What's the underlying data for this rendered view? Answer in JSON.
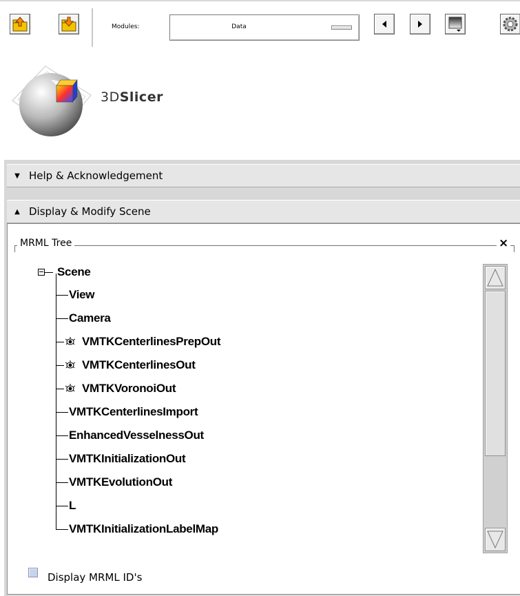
{
  "toolbar": {
    "modules_label": "Modules:",
    "module_selected": "Data",
    "buttons": [
      "load-scene-icon",
      "import-scene-icon",
      "prev-module-icon",
      "next-module-icon",
      "module-menu-icon",
      "settings-icon"
    ]
  },
  "logo": {
    "text_prefix": "3D",
    "text_bold": "Slicer"
  },
  "sections": {
    "help": {
      "label": "Help & Acknowledgement",
      "expanded": false
    },
    "display": {
      "label": "Display & Modify Scene",
      "expanded": true
    }
  },
  "mrml_tree": {
    "title": "MRML Tree",
    "close_glyph": "×",
    "root": "Scene",
    "items": [
      {
        "label": "View",
        "eye": false
      },
      {
        "label": "Camera",
        "eye": false
      },
      {
        "label": "VMTKCenterlinesPrepOut",
        "eye": true
      },
      {
        "label": "VMTKCenterlinesOut",
        "eye": true
      },
      {
        "label": "VMTKVoronoiOut",
        "eye": true
      },
      {
        "label": "VMTKCenterlinesImport",
        "eye": false
      },
      {
        "label": "EnhancedVesselnessOut",
        "eye": false
      },
      {
        "label": "VMTKInitializationOut",
        "eye": false
      },
      {
        "label": "VMTKEvolutionOut",
        "eye": false
      },
      {
        "label": "L",
        "eye": false
      },
      {
        "label": "VMTKInitializationLabelMap",
        "eye": false
      }
    ],
    "display_ids_label": "Display MRML ID's",
    "display_ids_checked": false
  },
  "colors": {
    "panel_bg": "#d8d8d8",
    "section_bg": "#e6e6e6",
    "checkbox": "#c8d4ec"
  }
}
